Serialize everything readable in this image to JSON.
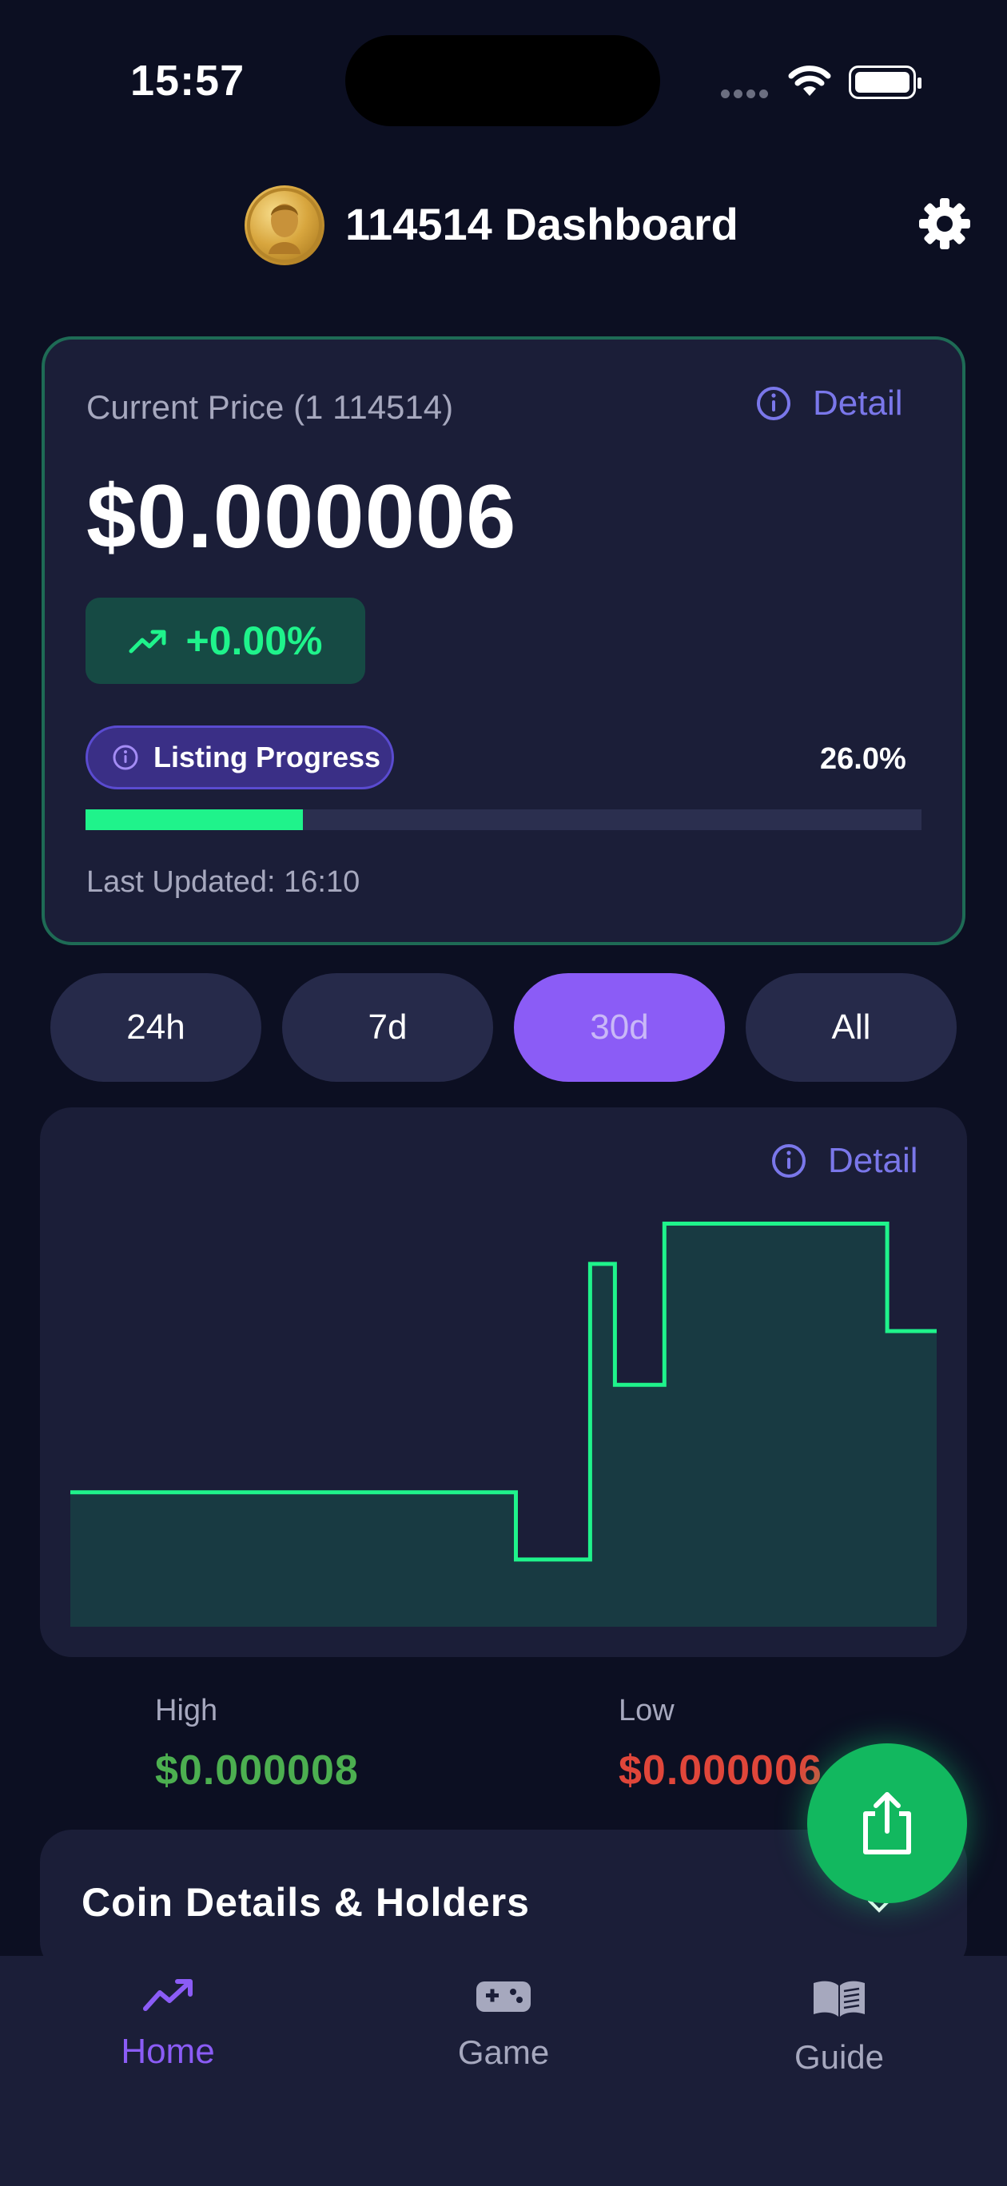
{
  "status_bar": {
    "time": "15:57"
  },
  "header": {
    "title": "114514 Dashboard",
    "avatar_icon": "gold-coin-avatar",
    "settings_icon": "gear-icon"
  },
  "price_card": {
    "label": "Current Price (1 114514)",
    "detail_label": "Detail",
    "price": "$0.000006",
    "change": "+0.00%",
    "listing_label": "Listing Progress",
    "listing_percent_text": "26.0%",
    "listing_progress": 0.26,
    "last_updated": "Last Updated: 16:10"
  },
  "ranges": [
    {
      "label": "24h",
      "active": false
    },
    {
      "label": "7d",
      "active": false
    },
    {
      "label": "30d",
      "active": true
    },
    {
      "label": "All",
      "active": false
    }
  ],
  "chart": {
    "detail_label": "Detail",
    "line_color": "#1ff38b",
    "fill_color": "#183a42"
  },
  "chart_data": {
    "type": "line",
    "step": true,
    "x": [
      0,
      18,
      20,
      66,
      69,
      77,
      75,
      54,
      52
    ],
    "points": [
      [
        0,
        6e-06
      ],
      [
        18,
        6e-06
      ],
      [
        18,
        5.5e-06
      ],
      [
        21,
        5.5e-06
      ],
      [
        21,
        7.7e-06
      ],
      [
        22,
        7.7e-06
      ],
      [
        22,
        6.8e-06
      ],
      [
        24,
        6.8e-06
      ],
      [
        24,
        8e-06
      ],
      [
        33,
        8e-06
      ],
      [
        33,
        7.2e-06
      ],
      [
        35,
        7.2e-06
      ]
    ],
    "ylim": [
      5e-06,
      8.3e-06
    ]
  },
  "stats": {
    "high_label": "High",
    "high_value": "$0.000008",
    "low_label": "Low",
    "low_value": "$0.000006"
  },
  "coin_details": {
    "title": "Coin Details & Holders"
  },
  "bottom_nav": [
    {
      "label": "Home",
      "icon": "trend-icon",
      "active": true
    },
    {
      "label": "Game",
      "icon": "gamepad-icon",
      "active": false
    },
    {
      "label": "Guide",
      "icon": "book-icon",
      "active": false
    }
  ],
  "colors": {
    "accent": "#8b5cf6",
    "positive": "#1ff38b",
    "high": "#4caf50",
    "low": "#e0463a"
  }
}
